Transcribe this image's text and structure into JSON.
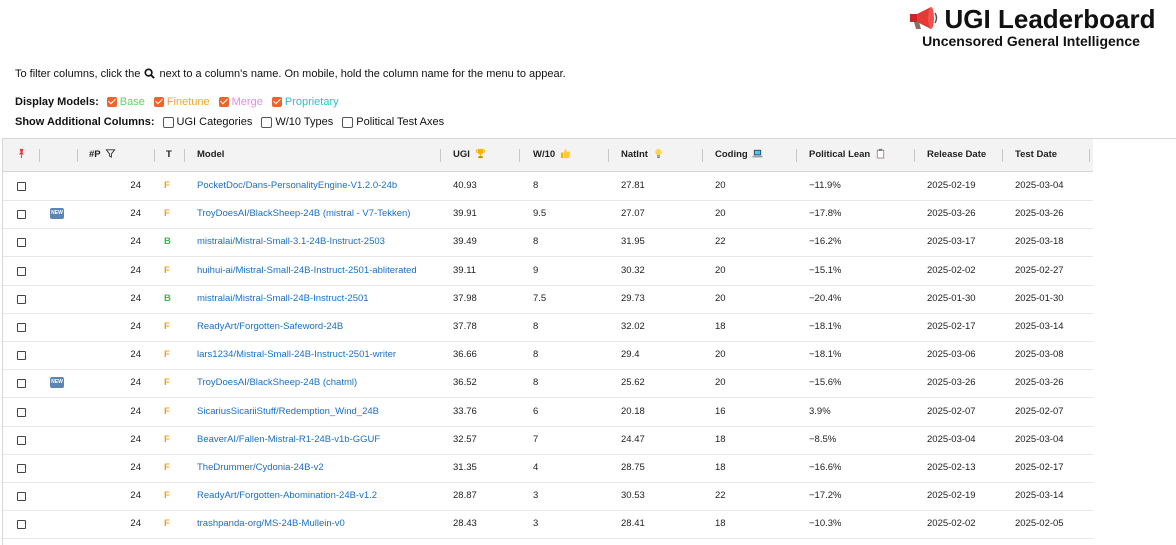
{
  "header": {
    "title": "UGI Leaderboard",
    "subtitle": "Uncensored General Intelligence",
    "icon": "megaphone-icon"
  },
  "instructions": {
    "before": "To filter columns, click the",
    "after": "next to a column's name. On mobile, hold the column name for the menu to appear.",
    "icon": "magnifier-icon"
  },
  "display_models": {
    "label": "Display Models:",
    "options": [
      {
        "label": "Base",
        "color": "#5fd36a",
        "checked": true
      },
      {
        "label": "Finetune",
        "color": "#f5a623",
        "checked": true
      },
      {
        "label": "Merge",
        "color": "#e58ae6",
        "checked": true
      },
      {
        "label": "Proprietary",
        "color": "#2ec1c7",
        "checked": true
      }
    ]
  },
  "additional_columns": {
    "label": "Show Additional Columns:",
    "options": [
      {
        "label": "UGI Categories",
        "checked": false
      },
      {
        "label": "W/10 Types",
        "checked": false
      },
      {
        "label": "Political Test Axes",
        "checked": false
      }
    ]
  },
  "table": {
    "headers": {
      "pin": "pin-icon",
      "params": "#P",
      "type": "T",
      "model": "Model",
      "ugi": "UGI",
      "w10": "W/10",
      "natint": "NatInt",
      "coding": "Coding",
      "political": "Political Lean",
      "release": "Release Date",
      "test": "Test Date"
    },
    "header_icons": {
      "params": "funnel-icon",
      "ugi": "trophy-icon",
      "w10": "thumbs-up-icon",
      "natint": "lightbulb-icon",
      "coding": "laptop-icon",
      "political": "clipboard-icon"
    },
    "new_badge": "NEW",
    "rows": [
      {
        "new": false,
        "params": "24",
        "type": "F",
        "model": "PocketDoc/Dans-PersonalityEngine-V1.2.0-24b",
        "ugi": "40.93",
        "w10": "8",
        "natint": "27.81",
        "coding": "20",
        "political": "−11.9%",
        "release": "2025-02-19",
        "test": "2025-03-04"
      },
      {
        "new": true,
        "params": "24",
        "type": "F",
        "model": "TroyDoesAI/BlackSheep-24B (mistral - V7-Tekken)",
        "ugi": "39.91",
        "w10": "9.5",
        "natint": "27.07",
        "coding": "20",
        "political": "−17.8%",
        "release": "2025-03-26",
        "test": "2025-03-26"
      },
      {
        "new": false,
        "params": "24",
        "type": "B",
        "model": "mistralai/Mistral-Small-3.1-24B-Instruct-2503",
        "ugi": "39.49",
        "w10": "8",
        "natint": "31.95",
        "coding": "22",
        "political": "−16.2%",
        "release": "2025-03-17",
        "test": "2025-03-18"
      },
      {
        "new": false,
        "params": "24",
        "type": "F",
        "model": "huihui-ai/Mistral-Small-24B-Instruct-2501-abliterated",
        "ugi": "39.11",
        "w10": "9",
        "natint": "30.32",
        "coding": "20",
        "political": "−15.1%",
        "release": "2025-02-02",
        "test": "2025-02-27"
      },
      {
        "new": false,
        "params": "24",
        "type": "B",
        "model": "mistralai/Mistral-Small-24B-Instruct-2501",
        "ugi": "37.98",
        "w10": "7.5",
        "natint": "29.73",
        "coding": "20",
        "political": "−20.4%",
        "release": "2025-01-30",
        "test": "2025-01-30"
      },
      {
        "new": false,
        "params": "24",
        "type": "F",
        "model": "ReadyArt/Forgotten-Safeword-24B",
        "ugi": "37.78",
        "w10": "8",
        "natint": "32.02",
        "coding": "18",
        "political": "−18.1%",
        "release": "2025-02-17",
        "test": "2025-03-14"
      },
      {
        "new": false,
        "params": "24",
        "type": "F",
        "model": "lars1234/Mistral-Small-24B-Instruct-2501-writer",
        "ugi": "36.66",
        "w10": "8",
        "natint": "29.4",
        "coding": "20",
        "political": "−18.1%",
        "release": "2025-03-06",
        "test": "2025-03-08"
      },
      {
        "new": true,
        "params": "24",
        "type": "F",
        "model": "TroyDoesAI/BlackSheep-24B (chatml)",
        "ugi": "36.52",
        "w10": "8",
        "natint": "25.62",
        "coding": "20",
        "political": "−15.6%",
        "release": "2025-03-26",
        "test": "2025-03-26"
      },
      {
        "new": false,
        "params": "24",
        "type": "F",
        "model": "SicariusSicariiStuff/Redemption_Wind_24B",
        "ugi": "33.76",
        "w10": "6",
        "natint": "20.18",
        "coding": "16",
        "political": "3.9%",
        "release": "2025-02-07",
        "test": "2025-02-07"
      },
      {
        "new": false,
        "params": "24",
        "type": "F",
        "model": "BeaverAI/Fallen-Mistral-R1-24B-v1b-GGUF",
        "ugi": "32.57",
        "w10": "7",
        "natint": "24.47",
        "coding": "18",
        "political": "−8.5%",
        "release": "2025-03-04",
        "test": "2025-03-04"
      },
      {
        "new": false,
        "params": "24",
        "type": "F",
        "model": "TheDrummer/Cydonia-24B-v2",
        "ugi": "31.35",
        "w10": "4",
        "natint": "28.75",
        "coding": "18",
        "political": "−16.6%",
        "release": "2025-02-13",
        "test": "2025-02-17"
      },
      {
        "new": false,
        "params": "24",
        "type": "F",
        "model": "ReadyArt/Forgotten-Abomination-24B-v1.2",
        "ugi": "28.87",
        "w10": "3",
        "natint": "30.53",
        "coding": "22",
        "political": "−17.2%",
        "release": "2025-02-19",
        "test": "2025-03-14"
      },
      {
        "new": false,
        "params": "24",
        "type": "F",
        "model": "trashpanda-org/MS-24B-Mullein-v0",
        "ugi": "28.43",
        "w10": "3",
        "natint": "28.41",
        "coding": "18",
        "political": "−10.3%",
        "release": "2025-02-02",
        "test": "2025-02-05"
      }
    ]
  }
}
